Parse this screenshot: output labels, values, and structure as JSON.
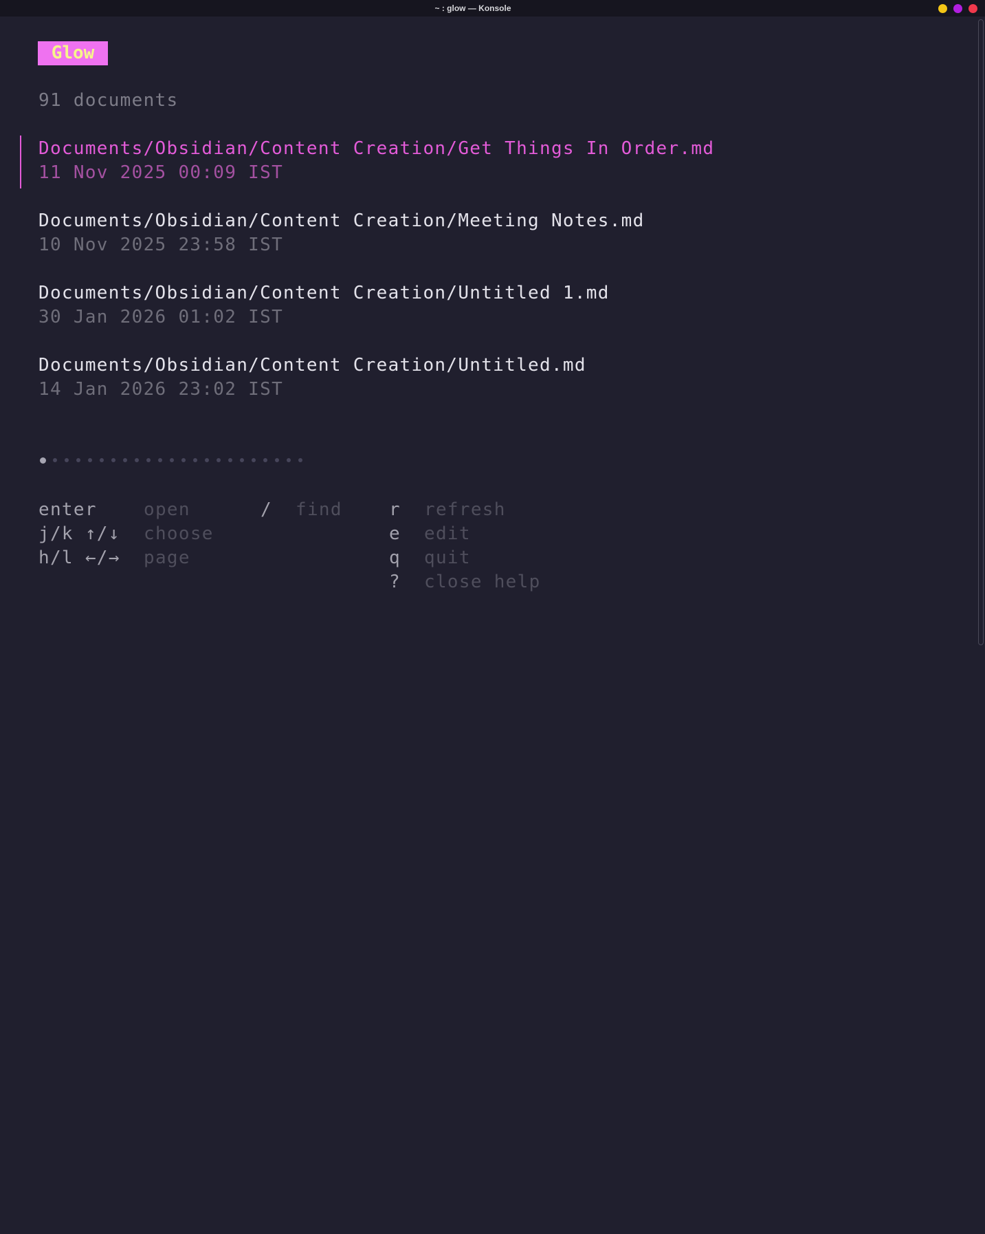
{
  "window": {
    "title": "~ : glow — Konsole",
    "buttons": [
      {
        "name": "minimize",
        "color": "#f3c516"
      },
      {
        "name": "maximize",
        "color": "#b11fe0"
      },
      {
        "name": "close",
        "color": "#f0394c"
      }
    ]
  },
  "app": {
    "name": "Glow",
    "badge_bg": "#ef72f0",
    "badge_fg": "#f6f58a",
    "document_count": "91 documents",
    "accent": "#e35bd8"
  },
  "documents": [
    {
      "path": "Documents/Obsidian/Content Creation/Get Things In Order.md",
      "date": "11 Nov 2025 00:09 IST",
      "selected": true
    },
    {
      "path": "Documents/Obsidian/Content Creation/Meeting Notes.md",
      "date": "10 Nov 2025 23:58 IST",
      "selected": false
    },
    {
      "path": "Documents/Obsidian/Content Creation/Untitled 1.md",
      "date": "30 Jan 2026 01:02 IST",
      "selected": false
    },
    {
      "path": "Documents/Obsidian/Content Creation/Untitled.md",
      "date": "14 Jan 2026 23:02 IST",
      "selected": false
    }
  ],
  "pagination": {
    "total_pages": 23,
    "current_page": 1
  },
  "help": [
    {
      "key": "enter",
      "desc": "open"
    },
    {
      "key": "j/k ↑/↓",
      "desc": "choose"
    },
    {
      "key": "h/l ←/→",
      "desc": "page"
    },
    {
      "key": "/",
      "desc": "find"
    },
    {
      "key": "r",
      "desc": "refresh"
    },
    {
      "key": "e",
      "desc": "edit"
    },
    {
      "key": "q",
      "desc": "quit"
    },
    {
      "key": "?",
      "desc": "close help"
    }
  ]
}
